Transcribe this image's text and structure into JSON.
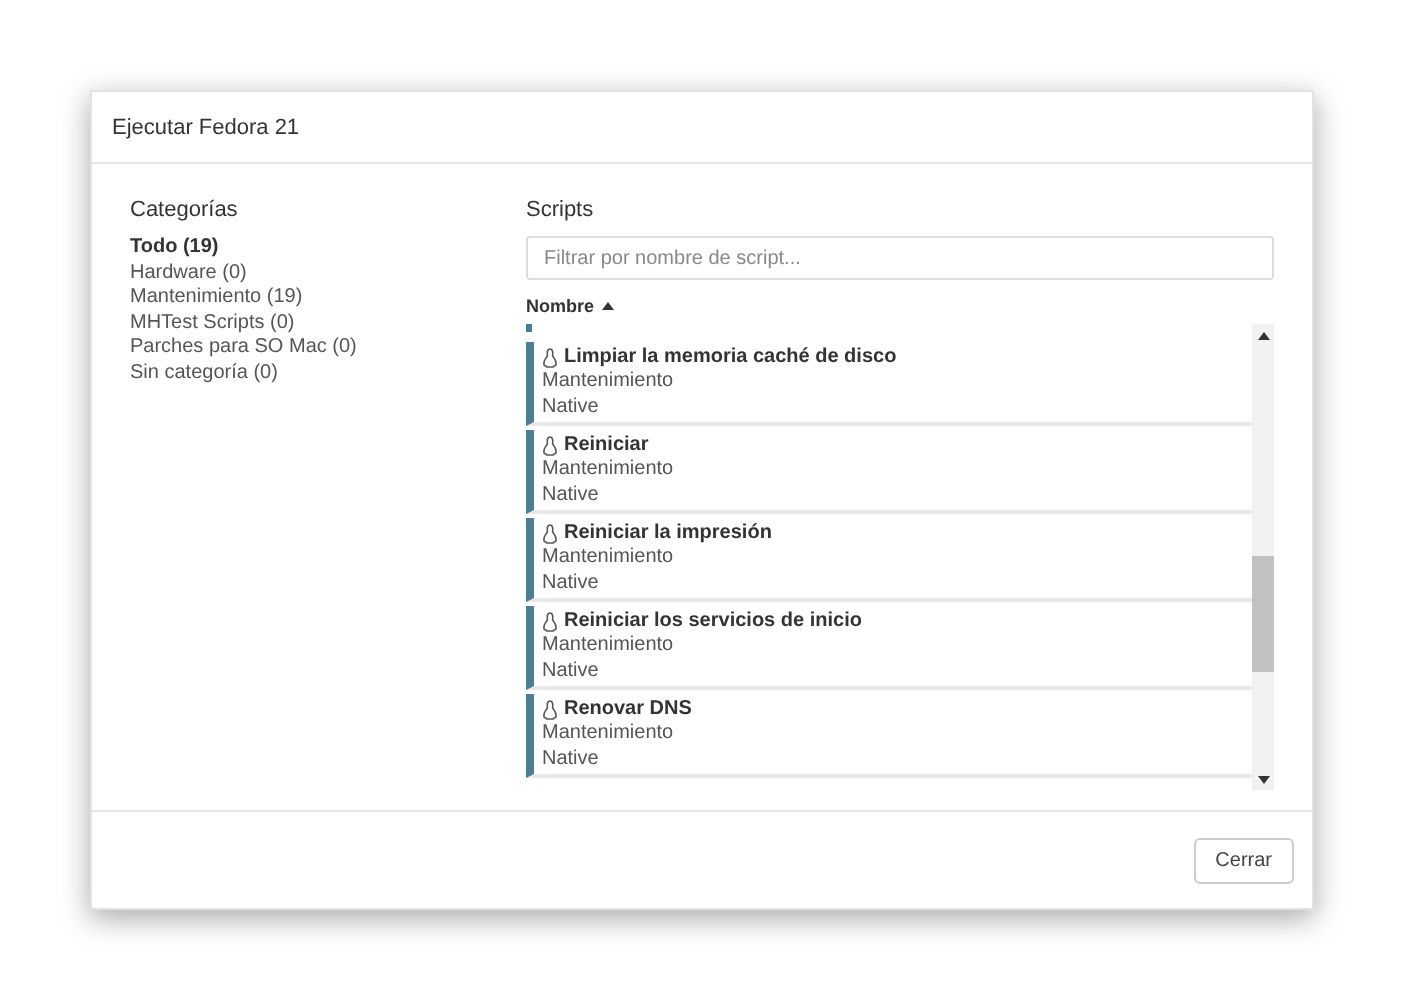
{
  "dialog": {
    "title": "Ejecutar Fedora 21"
  },
  "categories": {
    "heading": "Categorías",
    "items": [
      {
        "label": "Todo (19)",
        "selected": true
      },
      {
        "label": "Hardware (0)",
        "selected": false
      },
      {
        "label": "Mantenimiento (19)",
        "selected": false
      },
      {
        "label": "MHTest Scripts (0)",
        "selected": false
      },
      {
        "label": "Parches para SO Mac (0)",
        "selected": false
      },
      {
        "label": "Sin categoría (0)",
        "selected": false
      }
    ]
  },
  "scripts": {
    "heading": "Scripts",
    "filter": {
      "placeholder": "Filtrar por nombre de script..."
    },
    "sort_column": "Nombre",
    "items": [
      {
        "name": "Limpiar la memoria caché de disco",
        "category": "Mantenimiento",
        "type": "Native"
      },
      {
        "name": "Reiniciar",
        "category": "Mantenimiento",
        "type": "Native"
      },
      {
        "name": "Reiniciar la impresión",
        "category": "Mantenimiento",
        "type": "Native"
      },
      {
        "name": "Reiniciar los servicios de inicio",
        "category": "Mantenimiento",
        "type": "Native"
      },
      {
        "name": "Renovar DNS",
        "category": "Mantenimiento",
        "type": "Native"
      }
    ]
  },
  "buttons": [
    {
      "label": "Cerrar"
    }
  ]
}
